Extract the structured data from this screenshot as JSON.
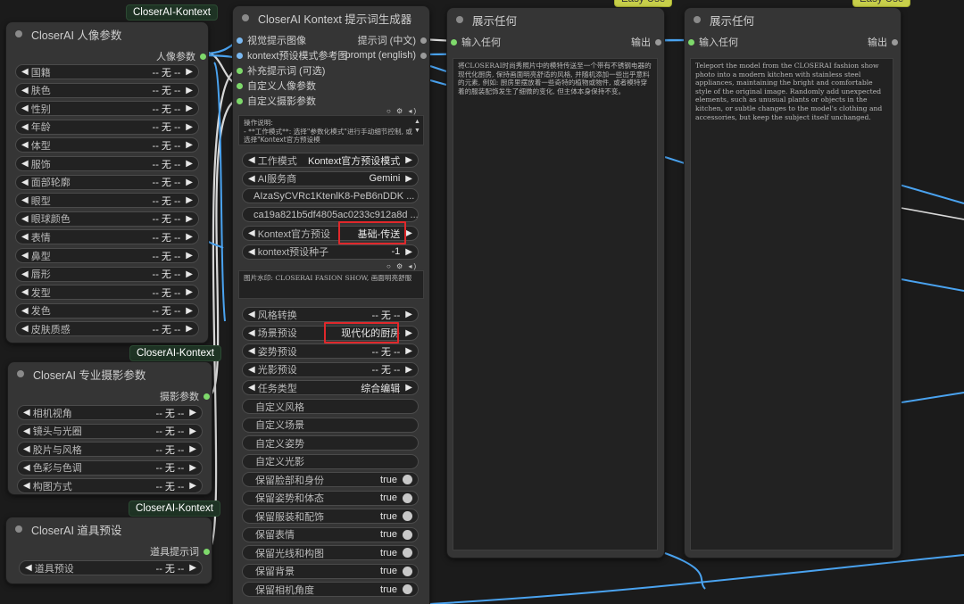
{
  "nodes": {
    "portrait": {
      "badge": "CloserAI-Kontext",
      "title": "CloserAI 人像参数",
      "output": "人像参数",
      "rows": [
        {
          "label": "国籍",
          "value": "-- 无 --"
        },
        {
          "label": "肤色",
          "value": "-- 无 --"
        },
        {
          "label": "性别",
          "value": "-- 无 --"
        },
        {
          "label": "年龄",
          "value": "-- 无 --"
        },
        {
          "label": "体型",
          "value": "-- 无 --"
        },
        {
          "label": "服饰",
          "value": "-- 无 --"
        },
        {
          "label": "面部轮廓",
          "value": "-- 无 --"
        },
        {
          "label": "眼型",
          "value": "-- 无 --"
        },
        {
          "label": "眼球颜色",
          "value": "-- 无 --"
        },
        {
          "label": "表情",
          "value": "-- 无 --"
        },
        {
          "label": "鼻型",
          "value": "-- 无 --"
        },
        {
          "label": "唇形",
          "value": "-- 无 --"
        },
        {
          "label": "发型",
          "value": "-- 无 --"
        },
        {
          "label": "发色",
          "value": "-- 无 --"
        },
        {
          "label": "皮肤质感",
          "value": "-- 无 --"
        }
      ]
    },
    "photo": {
      "badge": "CloserAI-Kontext",
      "title": "CloserAI 专业摄影参数",
      "output": "摄影参数",
      "rows": [
        {
          "label": "相机视角",
          "value": "-- 无 --"
        },
        {
          "label": "镜头与光圈",
          "value": "-- 无 --"
        },
        {
          "label": "胶片与风格",
          "value": "-- 无 --"
        },
        {
          "label": "色彩与色调",
          "value": "-- 无 --"
        },
        {
          "label": "构图方式",
          "value": "-- 无 --"
        }
      ]
    },
    "props": {
      "badge": "CloserAI-Kontext",
      "title": "CloserAI 道具预设",
      "output": "道具提示词",
      "rows": [
        {
          "label": "道具预设",
          "value": "-- 无 --"
        }
      ]
    },
    "generator": {
      "title": "CloserAI Kontext 提示词生成器",
      "inputs": [
        "视觉提示图像",
        "kontext预设模式参考图",
        "补充提示词 (可选)",
        "自定义人像参数",
        "自定义摄影参数"
      ],
      "outputs": [
        "提示词 (中文)",
        "prompt (english)"
      ],
      "instructions": "操作说明:\n- **工作模式**: 选择\"参数化模式\"进行手动细节控制, 或选择\"Kontext官方预设模",
      "combos_a": [
        {
          "label": "工作模式",
          "value": "Kontext官方预设模式"
        },
        {
          "label": "AI服务商",
          "value": "Gemini"
        }
      ],
      "api_key": "AIzaSyCVRc1KtenlK8-PeB6nDDK ...",
      "secret_key": "ca19a821b5df4805ac0233c912a8d ...",
      "combos_b": [
        {
          "label": "Kontext官方预设",
          "value": "基础-传送"
        },
        {
          "label": "kontext预设种子",
          "value": "-1"
        }
      ],
      "watermark": "图片水印: CLOSERAI FASION SHOW, 画面明亮舒服",
      "combos_c": [
        {
          "label": "风格转换",
          "value": "-- 无 --"
        },
        {
          "label": "场景预设",
          "value": "现代化的厨房"
        },
        {
          "label": "姿势预设",
          "value": "-- 无 --"
        },
        {
          "label": "光影预设",
          "value": "-- 无 --"
        },
        {
          "label": "任务类型",
          "value": "综合编辑"
        }
      ],
      "text_fields": [
        "自定义风格",
        "自定义场景",
        "自定义姿势",
        "自定义光影"
      ],
      "toggles": [
        {
          "label": "保留脸部和身份",
          "value": "true"
        },
        {
          "label": "保留姿势和体态",
          "value": "true"
        },
        {
          "label": "保留服装和配饰",
          "value": "true"
        },
        {
          "label": "保留表情",
          "value": "true"
        },
        {
          "label": "保留光线和构图",
          "value": "true"
        },
        {
          "label": "保留背景",
          "value": "true"
        },
        {
          "label": "保留相机角度",
          "value": "true"
        }
      ]
    },
    "show_cn": {
      "badge": "Easy Use",
      "title": "展示任何",
      "input": "输入任何",
      "output": "输出",
      "text": "将CLOSERAI时尚秀照片中的模特传送至一个带有不锈钢电器的现代化厨房, 保持画面明亮舒适的风格, 并随机添加一些出乎意料的元素, 例如: 厨房里摆放着一些奇特的植物或物件, 或者模特穿着的服装配饰发生了细微的变化, 但主体本身保持不变。"
    },
    "show_en": {
      "badge": "Easy Use",
      "title": "展示任何",
      "input": "输入任何",
      "output": "输出",
      "text": "Teleport the model from the CLOSERAI fashion show photo into a modern kitchen with stainless steel appliances, maintaining the bright and comfortable style of the original image. Randomly add unexpected elements, such as unusual plants or objects in the kitchen, or subtle changes to the model's clothing and accessories, but keep the subject itself unchanged."
    }
  },
  "colors": {
    "canvas": "#1b1b1b",
    "node": "#353535",
    "widget": "#222222",
    "wire_blue": "#4aa3f0",
    "wire_gray": "#d8d8d8",
    "socket_green": "#7ed96b",
    "highlight": "#e0282b"
  }
}
